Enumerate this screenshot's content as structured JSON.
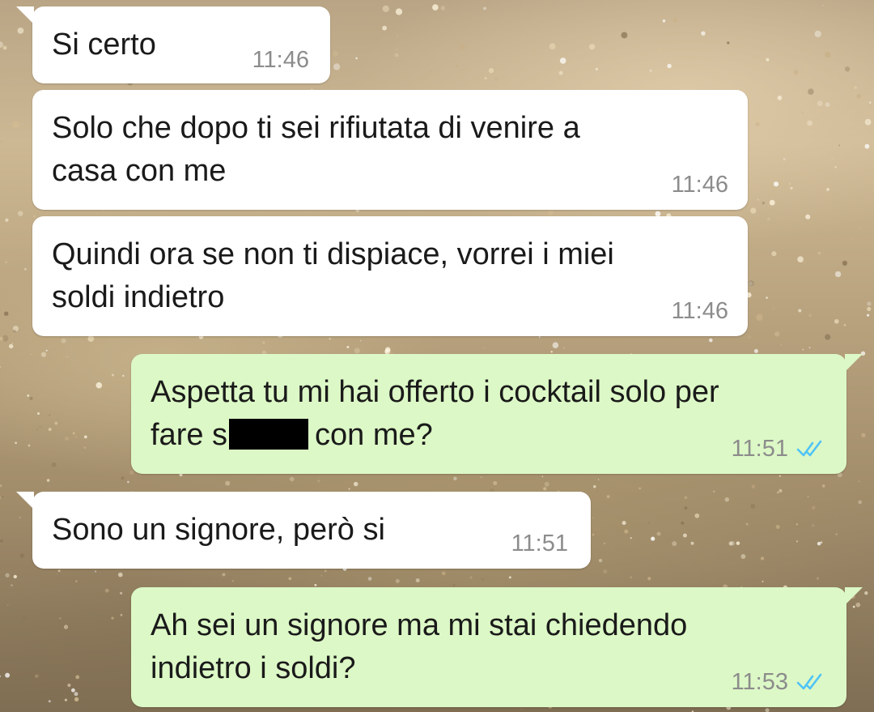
{
  "colors": {
    "incoming_bubble": "#ffffff",
    "outgoing_bubble": "#dcf8c6",
    "timestamp": "#8c8c8c",
    "read_ticks": "#4fc3f7",
    "redaction": "#000000"
  },
  "messages": [
    {
      "direction": "incoming",
      "lines": [
        "Si certo"
      ],
      "time": "11:46"
    },
    {
      "direction": "incoming",
      "lines": [
        "Solo che dopo ti sei rifiutata di venire a",
        "casa con me"
      ],
      "time": "11:46"
    },
    {
      "direction": "incoming",
      "lines": [
        "Quindi ora se non ti dispiace, vorrei i miei",
        "soldi indietro"
      ],
      "time": "11:46"
    },
    {
      "direction": "outgoing",
      "lines": [
        "Aspetta tu mi hai offerto i cocktail solo per"
      ],
      "line2_before_redaction": "fare s",
      "line2_after_redaction": "con me?",
      "time": "11:51",
      "status_icon": "double-check-read-icon"
    },
    {
      "direction": "incoming",
      "lines": [
        "Sono un signore, però si"
      ],
      "time": "11:51"
    },
    {
      "direction": "outgoing",
      "lines": [
        "Ah sei un signore ma mi stai chiedendo",
        "indietro i soldi?"
      ],
      "time": "11:53",
      "status_icon": "double-check-read-icon"
    }
  ]
}
